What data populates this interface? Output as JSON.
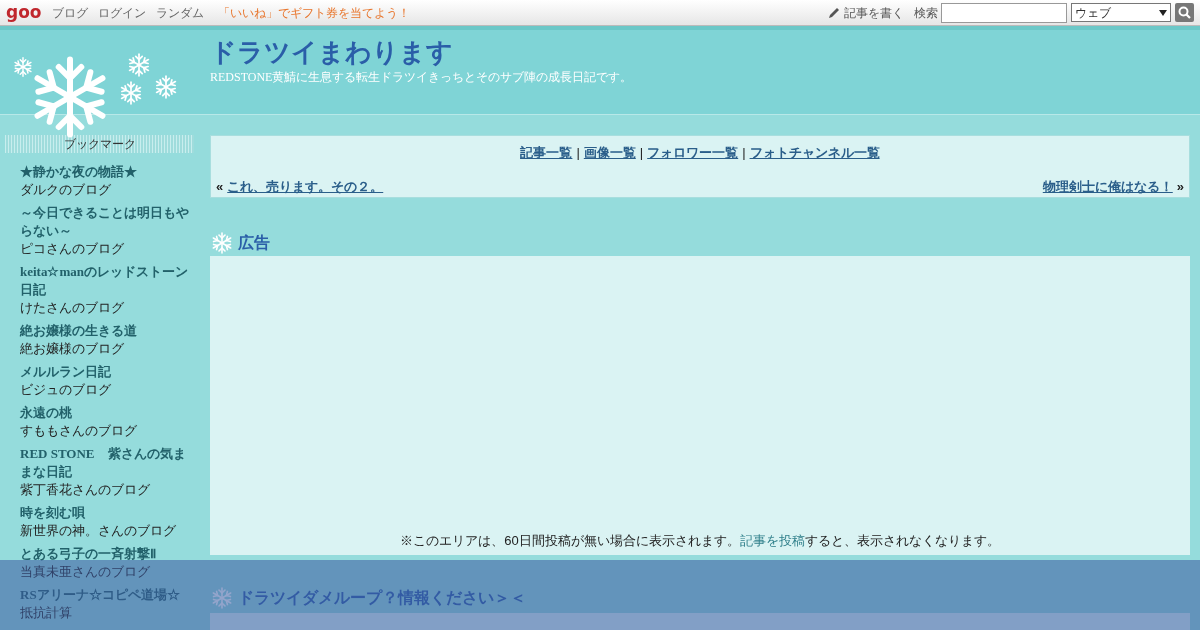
{
  "topbar": {
    "logo": "goo",
    "links": [
      "ブログ",
      "ログイン",
      "ランダム"
    ],
    "promo": "「いいね」でギフト券を当てよう！",
    "write": "記事を書く",
    "search_label": "検索",
    "search_scope": "ウェブ"
  },
  "header": {
    "title": "ドラツイまわります",
    "subtitle": "REDSTONE黄鯖に生息する転生ドラツイきっちとそのサブ陣の成長日記です。"
  },
  "sidebar": {
    "heading": "ブックマーク",
    "items": [
      {
        "title": "★静かな夜の物語★",
        "subtitle": "ダルクのブログ"
      },
      {
        "title": "～今日できることは明日もやらない～",
        "subtitle": "ピコさんのブログ"
      },
      {
        "title": "keita☆manのレッドストーン日記",
        "subtitle": "けたさんのブログ"
      },
      {
        "title": "絶お嬢様の生きる道",
        "subtitle": "絶お嬢様のブログ"
      },
      {
        "title": "メルルラン日記",
        "subtitle": "ビジュのブログ"
      },
      {
        "title": "永遠の桃",
        "subtitle": "すももさんのブログ"
      },
      {
        "title": "RED STONE　紫さんの気ままな日記",
        "subtitle": "紫丁香花さんのブログ"
      },
      {
        "title": "時を刻む唄",
        "subtitle": "新世界の神。さんのブログ"
      },
      {
        "title": "とある弓子の一斉射撃Ⅱ",
        "subtitle": "当真未亜さんのブログ"
      },
      {
        "title": "RSアリーナ☆コピペ道場☆",
        "subtitle": "抵抗計算"
      }
    ]
  },
  "nav": {
    "links": [
      "記事一覧",
      "画像一覧",
      "フォロワー一覧",
      "フォトチャンネル一覧"
    ],
    "separator": "|",
    "prev_mark": "«",
    "prev": "これ、売ります。その２。",
    "next": "物理剣士に俺はなる！",
    "next_mark": "»"
  },
  "ad": {
    "heading": "広告",
    "notice_before": "※このエリアは、60日間投稿が無い場合に表示されます。",
    "notice_link": "記事を投稿",
    "notice_after": "すると、表示されなくなります。"
  },
  "next_section": {
    "heading": "ドラツイダメループ？情報ください＞＜"
  }
}
